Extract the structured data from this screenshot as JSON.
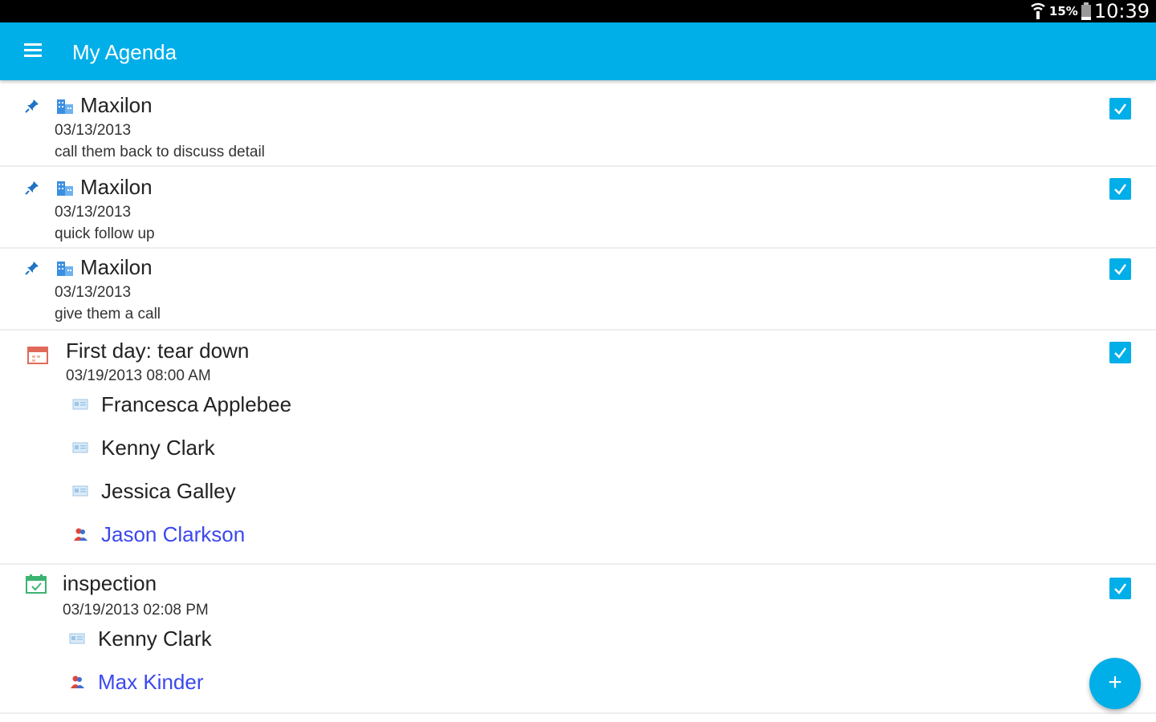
{
  "status_bar": {
    "battery_pct": "15%",
    "time": "10:39",
    "icons": [
      "wifi-icon",
      "battery-icon"
    ]
  },
  "app_bar": {
    "title": "My Agenda",
    "menu_icon": "hamburger-menu-icon"
  },
  "items": [
    {
      "type": "task",
      "title": "Maxilon",
      "date": "03/13/2013",
      "note": "call them back to discuss detail",
      "checked": true
    },
    {
      "type": "task",
      "title": "Maxilon",
      "date": "03/13/2013",
      "note": "quick follow up",
      "checked": true
    },
    {
      "type": "task",
      "title": "Maxilon",
      "date": "03/13/2013",
      "note": "give them a call",
      "checked": true
    },
    {
      "type": "event",
      "title": "First day: tear down",
      "date": "03/19/2013 08:00 AM",
      "checked": true,
      "attendees": [
        {
          "name": "Francesca Applebee",
          "kind": "contact"
        },
        {
          "name": "Kenny Clark",
          "kind": "contact"
        },
        {
          "name": "Jessica Galley",
          "kind": "contact"
        },
        {
          "name": "Jason Clarkson",
          "kind": "user"
        }
      ]
    },
    {
      "type": "event",
      "title": "inspection",
      "date": "03/19/2013 02:08 PM",
      "checked": true,
      "attendees": [
        {
          "name": "Kenny Clark",
          "kind": "contact"
        },
        {
          "name": "Max Kinder",
          "kind": "user"
        }
      ]
    }
  ],
  "fab": {
    "label": "+"
  },
  "colors": {
    "accent": "#00aee8",
    "link": "#3b48ee",
    "status_bar": "#000000"
  }
}
